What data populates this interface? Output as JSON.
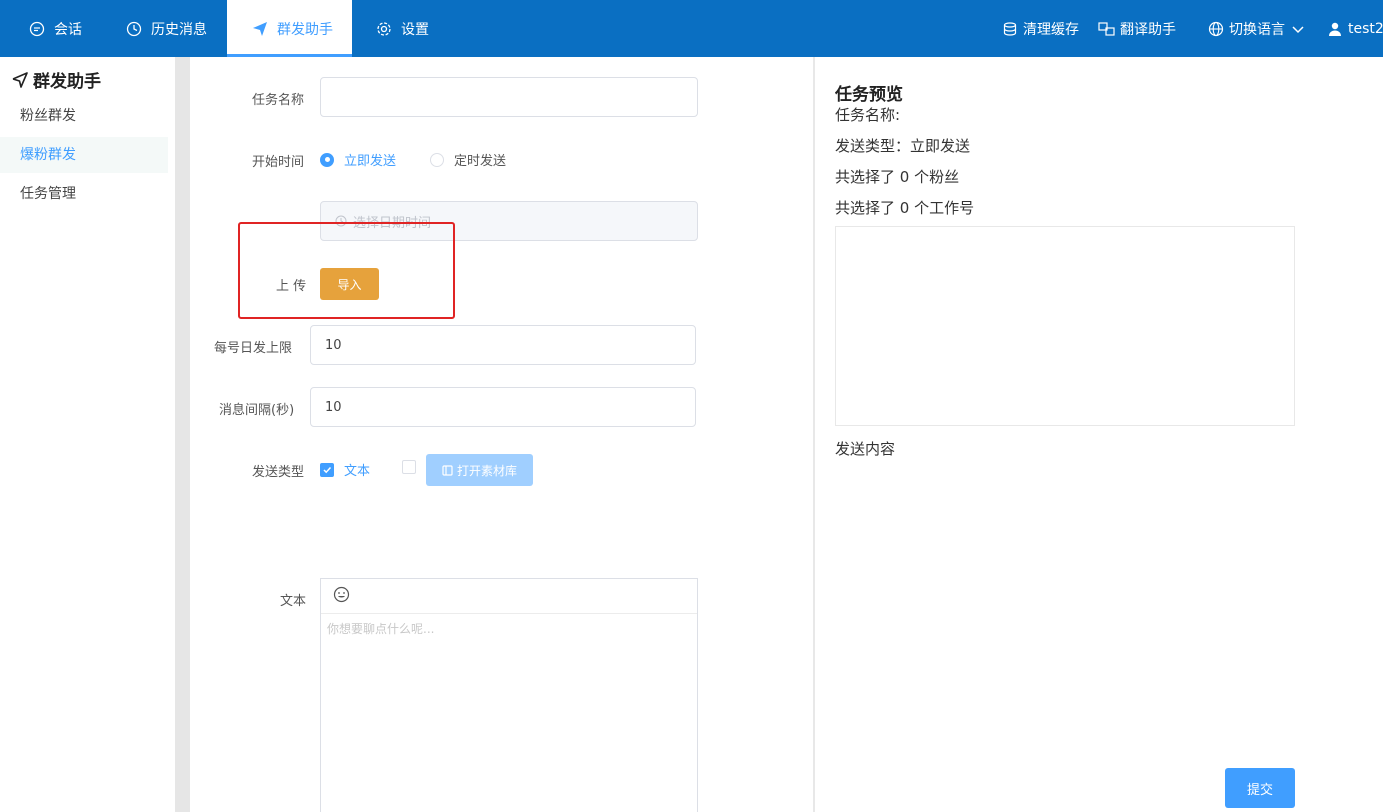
{
  "topnav": {
    "items": [
      {
        "label": "会话",
        "icon": "chat-bubble-icon"
      },
      {
        "label": "历史消息",
        "icon": "clock-icon"
      },
      {
        "label": "群发助手",
        "icon": "paper-plane-icon",
        "active": true
      },
      {
        "label": "设置",
        "icon": "gear-icon"
      }
    ],
    "right": {
      "clear_cache": "清理缓存",
      "translate": "翻译助手",
      "language": "切换语言",
      "user": "test2"
    }
  },
  "sidebar": {
    "title": "群发助手",
    "items": [
      {
        "label": "粉丝群发"
      },
      {
        "label": "爆粉群发",
        "active": true
      },
      {
        "label": "任务管理"
      }
    ]
  },
  "form": {
    "task_name_label": "任务名称",
    "task_name_value": "",
    "start_time_label": "开始时间",
    "radio_now": "立即发送",
    "radio_scheduled": "定时发送",
    "datetime_placeholder": "选择日期时间",
    "upload_label": "上 传",
    "import_button": "导入",
    "daily_limit_label": "每号日发上限",
    "daily_limit_value": "10",
    "interval_label": "消息间隔(秒)",
    "interval_value": "10",
    "send_type_label": "发送类型",
    "check_text": "文本",
    "open_library_button": "打开素材库",
    "text_label": "文本",
    "text_placeholder": "你想要聊点什么呢..."
  },
  "preview": {
    "title": "任务预览",
    "task_name": "任务名称:",
    "send_type": "发送类型：立即发送",
    "fans_count": "共选择了 0 个粉丝",
    "accounts_count": "共选择了 0 个工作号",
    "content_label": "发送内容",
    "submit_button": "提交"
  },
  "colors": {
    "topbar": "#0a6fc2",
    "accent": "#409eff",
    "import_button": "#e6a23c",
    "highlight": "#e02424"
  }
}
